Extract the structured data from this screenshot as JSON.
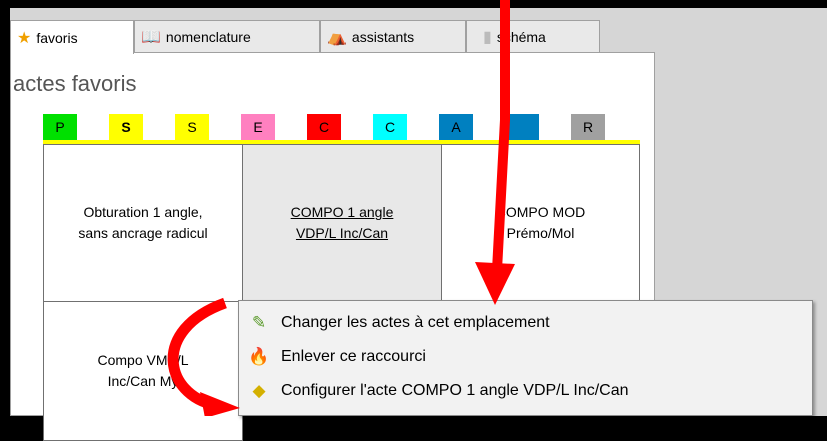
{
  "tabs": [
    {
      "label": "favoris",
      "icon": "star-icon",
      "active": true
    },
    {
      "label": "nomenclature",
      "icon": "book-icon",
      "active": false
    },
    {
      "label": "assistants",
      "icon": "wizard-icon",
      "active": false
    },
    {
      "label": "schéma",
      "icon": "tooth-icon",
      "active": false
    }
  ],
  "panel": {
    "title": "actes favoris"
  },
  "chips": [
    {
      "label": "P",
      "color": "#00e000"
    },
    {
      "label": "S",
      "color": "#ffff00",
      "selected": true
    },
    {
      "label": "S",
      "color": "#ffff00"
    },
    {
      "label": "E",
      "color": "#ff80c0"
    },
    {
      "label": "C",
      "color": "#ff0000"
    },
    {
      "label": "C",
      "color": "#00ffff"
    },
    {
      "label": "A",
      "color": "#0080c0"
    },
    {
      "label": "",
      "color": "#0080c0"
    },
    {
      "label": "R",
      "color": "#a0a0a0"
    }
  ],
  "cells": [
    {
      "text": "Obturation 1 angle,\nsans ancrage radicul"
    },
    {
      "text": "COMPO 1 angle\nVDP/L Inc/Can",
      "highlighted": true
    },
    {
      "text": "COMPO MOD\nPrémo/Mol"
    },
    {
      "text": "Compo VMP/L\nInc/Can My"
    }
  ],
  "context_menu": {
    "items": [
      {
        "label": "Changer les actes à cet emplacement",
        "icon": "pencil-icon"
      },
      {
        "label": "Enlever ce raccourci",
        "icon": "fire-icon"
      },
      {
        "label": "Configurer l'acte COMPO 1 angle VDP/L Inc/Can",
        "icon": "eraser-icon"
      }
    ]
  },
  "colors": {
    "annotation": "#ff0000",
    "accent_line": "#ffff00",
    "menu_highlight": "#cce4f7"
  }
}
